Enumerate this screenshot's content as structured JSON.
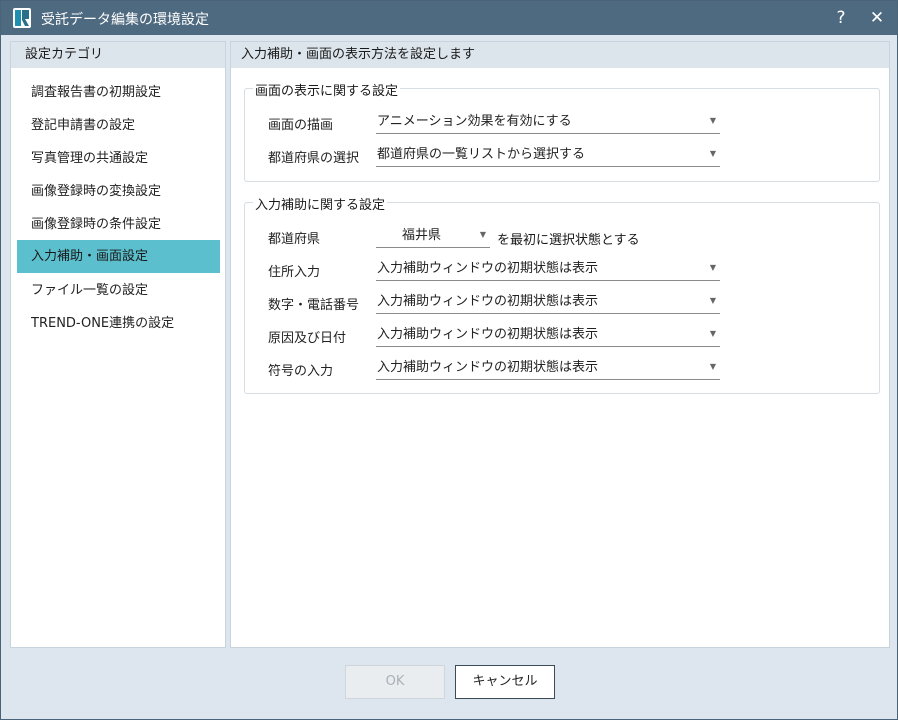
{
  "window": {
    "title": "受託データ編集の環境設定",
    "help_label": "?",
    "close_label": "✕"
  },
  "sidebar": {
    "header": "設定カテゴリ",
    "items": [
      {
        "label": "調査報告書の初期設定"
      },
      {
        "label": "登記申請書の設定"
      },
      {
        "label": "写真管理の共通設定"
      },
      {
        "label": "画像登録時の変換設定"
      },
      {
        "label": "画像登録時の条件設定"
      },
      {
        "label": "入力補助・画面設定",
        "active": true
      },
      {
        "label": "ファイル一覧の設定"
      },
      {
        "label": "TREND-ONE連携の設定"
      }
    ]
  },
  "main": {
    "header": "入力補助・画面の表示方法を設定します",
    "display_group": {
      "title": "画面の表示に関する設定",
      "rows": [
        {
          "label": "画面の描画",
          "value": "アニメーション効果を有効にする"
        },
        {
          "label": "都道府県の選択",
          "value": "都道府県の一覧リストから選択する"
        }
      ]
    },
    "input_group": {
      "title": "入力補助に関する設定",
      "prefecture_label": "都道府県",
      "prefecture_value": "福井県",
      "prefecture_suffix": "を最初に選択状態とする",
      "rows": [
        {
          "label": "住所入力",
          "value": "入力補助ウィンドウの初期状態は表示"
        },
        {
          "label": "数字・電話番号",
          "value": "入力補助ウィンドウの初期状態は表示"
        },
        {
          "label": "原因及び日付",
          "value": "入力補助ウィンドウの初期状態は表示"
        },
        {
          "label": "符号の入力",
          "value": "入力補助ウィンドウの初期状態は表示"
        }
      ]
    }
  },
  "footer": {
    "ok_label": "OK",
    "ok_enabled": false,
    "cancel_label": "キャンセル"
  },
  "colors": {
    "titlebar": "#4e6a80",
    "accent": "#5bbfcd",
    "frame": "#dde6ee"
  },
  "icons": {
    "app": "app-logo-icon",
    "arrow": "chevron-down-icon"
  }
}
